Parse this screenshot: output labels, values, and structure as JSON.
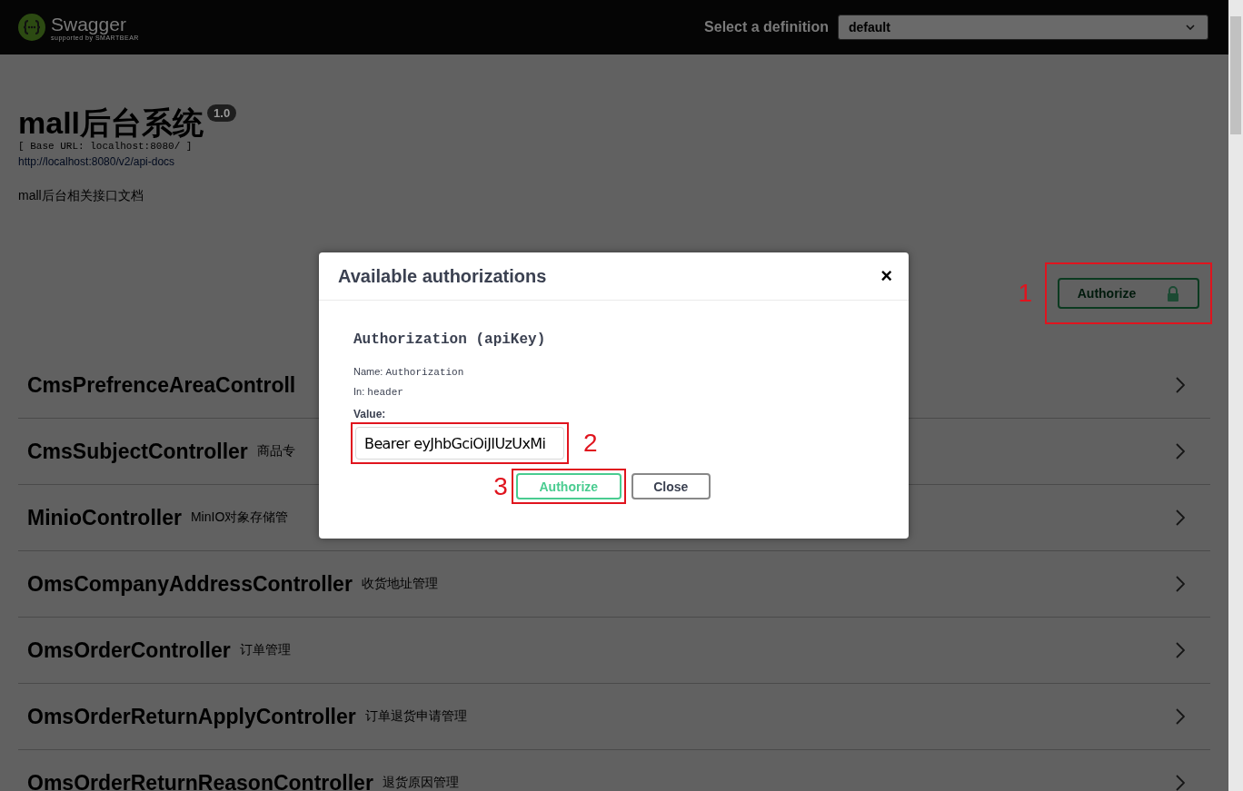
{
  "header": {
    "logo_name": "Swagger",
    "logo_tagline": "supported by SMARTBEAR",
    "definition_label": "Select a definition",
    "definition_value": "default"
  },
  "info": {
    "title": "mall后台系统",
    "version": "1.0",
    "base_url": "[ Base URL: localhost:8080/ ]",
    "docs_link": "http://localhost:8080/v2/api-docs",
    "description": "mall后台相关接口文档"
  },
  "authorize_button": {
    "label": "Authorize",
    "annotation": "1"
  },
  "controllers": [
    {
      "name": "CmsPrefrenceAreaControll"
    },
    {
      "name": "CmsSubjectController",
      "description": "商品专"
    },
    {
      "name": "MinioController",
      "description": "MinIO对象存储管"
    },
    {
      "name": "OmsCompanyAddressController",
      "description": "收货地址管理"
    },
    {
      "name": "OmsOrderController",
      "description": "订单管理"
    },
    {
      "name": "OmsOrderReturnApplyController",
      "description": "订单退货申请管理"
    },
    {
      "name": "OmsOrderReturnReasonController",
      "description": "退货原因管理"
    }
  ],
  "dialog": {
    "title": "Available authorizations",
    "close_icon": "×",
    "scheme_title": "Authorization (apiKey)",
    "name_label": "Name:",
    "name_value": "Authorization",
    "in_label": "In:",
    "in_value": "header",
    "value_label": "Value:",
    "value": "Bearer eyJhbGciOiJIUzUxMi",
    "value_annotation": "2",
    "authorize_label": "Authorize",
    "authorize_annotation": "3",
    "close_label": "Close"
  }
}
